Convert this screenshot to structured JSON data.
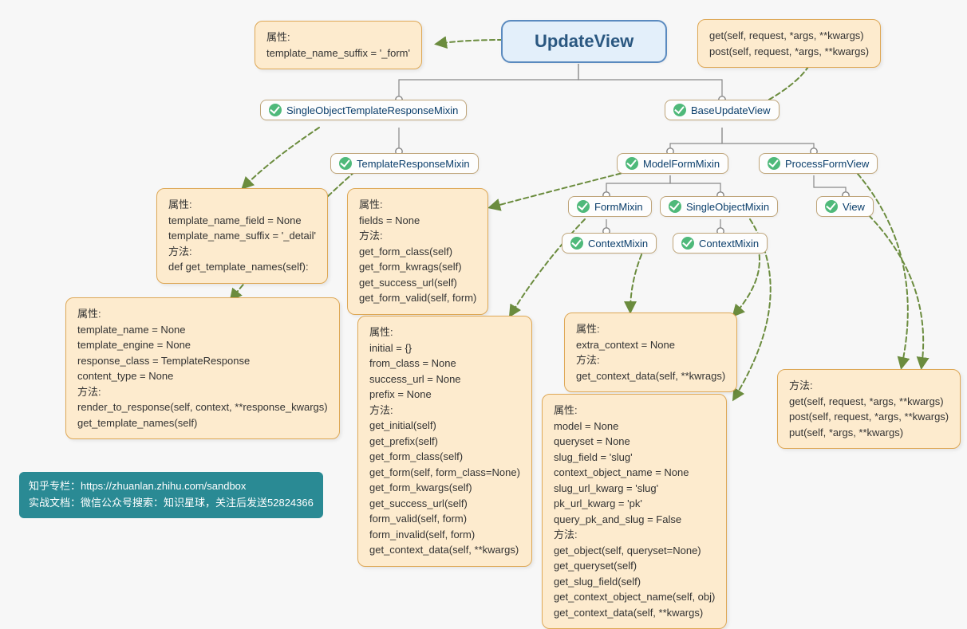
{
  "root": "UpdateView",
  "classes": {
    "sotrm": "SingleObjectTemplateResponseMixin",
    "buv": "BaseUpdateView",
    "trm": "TemplateResponseMixin",
    "mfm": "ModelFormMixin",
    "pfv": "ProcessFormView",
    "fm": "FormMixin",
    "som": "SingleObjectMixin",
    "view": "View",
    "cm1": "ContextMixin",
    "cm2": "ContextMixin"
  },
  "boxes": {
    "b_root_attr": "属性:\ntemplate_name_suffix = '_form'",
    "b_buv_methods": "get(self, request, *args, **kwargs)\npost(self, request, *args, **kwargs)",
    "b_sotrm": "属性:\ntemplate_name_field = None\ntemplate_name_suffix = '_detail'\n方法:\ndef get_template_names(self):",
    "b_trm": "属性:\ntemplate_name = None\ntemplate_engine = None\nresponse_class = TemplateResponse\ncontent_type = None\n方法:\nrender_to_response(self, context, **response_kwargs)\nget_template_names(self)",
    "b_mfm": "属性:\nfields = None\n方法:\nget_form_class(self)\nget_form_kwrags(self)\nget_success_url(self)\nget_form_valid(self, form)",
    "b_cm": "属性:\nextra_context = None\n方法:\nget_context_data(self, **kwrags)",
    "b_pfv": "方法:\nget(self, request, *args, **kwargs)\npost(self, request, *args, **kwargs)\nput(self, *args, **kwargs)",
    "b_fm": "属性:\ninitial = {}\nfrom_class = None\nsuccess_url = None\nprefix = None\n方法:\nget_initial(self)\nget_prefix(self)\nget_form_class(self)\nget_form(self, form_class=None)\nget_form_kwargs(self)\nget_success_url(self)\nform_valid(self, form)\nform_invalid(self, form)\nget_context_data(self, **kwargs)",
    "b_som": "属性:\nmodel = None\nqueryset = None\nslug_field = 'slug'\ncontext_object_name = None\nslug_url_kwarg = 'slug'\npk_url_kwarg = 'pk'\nquery_pk_and_slug = False\n方法:\nget_object(self, queryset=None)\nget_queryset(self)\nget_slug_field(self)\nget_context_object_name(self, obj)\nget_context_data(self, **kwargs)"
  },
  "credit": "知乎专栏：https://zhuanlan.zhihu.com/sandbox\n实战文档：微信公众号搜索：知识星球，关注后发送52824366"
}
